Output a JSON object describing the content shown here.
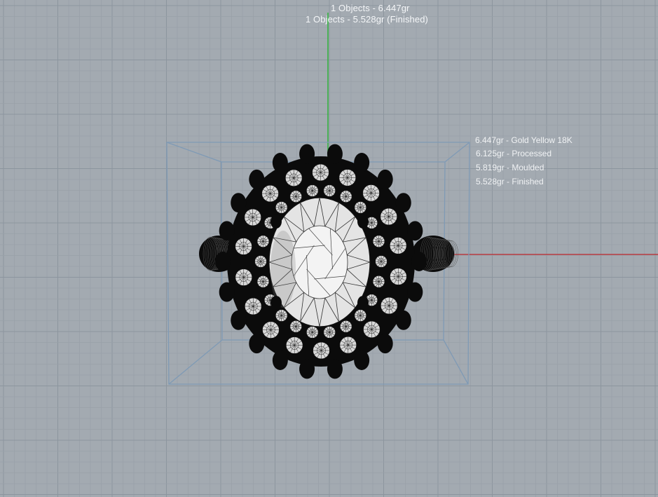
{
  "hud": {
    "objects_weight": "1 Objects  - 6.447gr",
    "objects_finished": "1 Objects  - 5.528gr (Finished)"
  },
  "materials": [
    "6.447gr - Gold Yellow 18K",
    "6.125gr - Processed",
    "5.819gr - Moulded",
    "5.528gr - Finished"
  ],
  "colors": {
    "background": "#a3aab1",
    "grid_minor": "#98a0a8",
    "grid_major": "#8c959e",
    "axis_y": "#2fb33a",
    "axis_x": "#b83a40",
    "bounding_box": "#7f9ab5",
    "metal": "#0b0b0b",
    "gem": "#d8d8d8"
  },
  "icons": [
    "axis-y-line",
    "axis-x-line",
    "bounding-box",
    "ring-model"
  ]
}
